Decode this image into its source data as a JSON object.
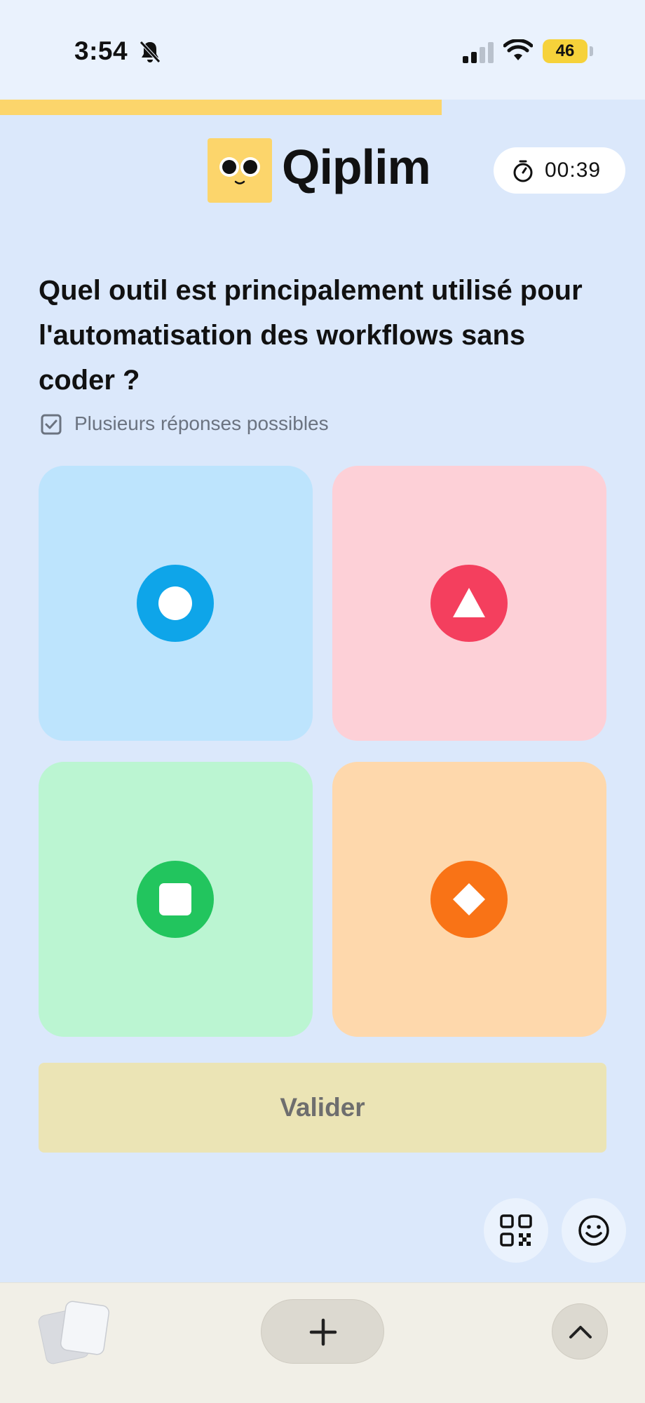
{
  "status_bar": {
    "time": "3:54",
    "battery": "46",
    "icons": [
      "bell-muted-icon",
      "signal-icon",
      "wifi-icon",
      "battery-icon"
    ]
  },
  "progress": {
    "fraction": 0.685,
    "color": "#fcd56b"
  },
  "header": {
    "logo": "Qiplim",
    "timer": "00:39"
  },
  "question": {
    "text": "Quel outil est principalement utilisé pour l'automatisation des workflows sans coder ?",
    "hint": "Plusieurs réponses possibles"
  },
  "answers": [
    {
      "shape": "circle",
      "tile_color": "#bde4fd",
      "badge_color": "#0ea5e9"
    },
    {
      "shape": "triangle",
      "tile_color": "#fdd0d7",
      "badge_color": "#f43f5e"
    },
    {
      "shape": "square",
      "tile_color": "#bbf5d2",
      "badge_color": "#22c55e"
    },
    {
      "shape": "diamond",
      "tile_color": "#fed8ac",
      "badge_color": "#f97316"
    }
  ],
  "actions": {
    "validate_label": "Valider",
    "validate_color": "#ebe4b5"
  },
  "floating": [
    "qr-code-icon",
    "smiley-icon"
  ],
  "browser": {
    "icons": [
      "tabs-icon",
      "plus-icon",
      "chevron-up-icon"
    ]
  }
}
